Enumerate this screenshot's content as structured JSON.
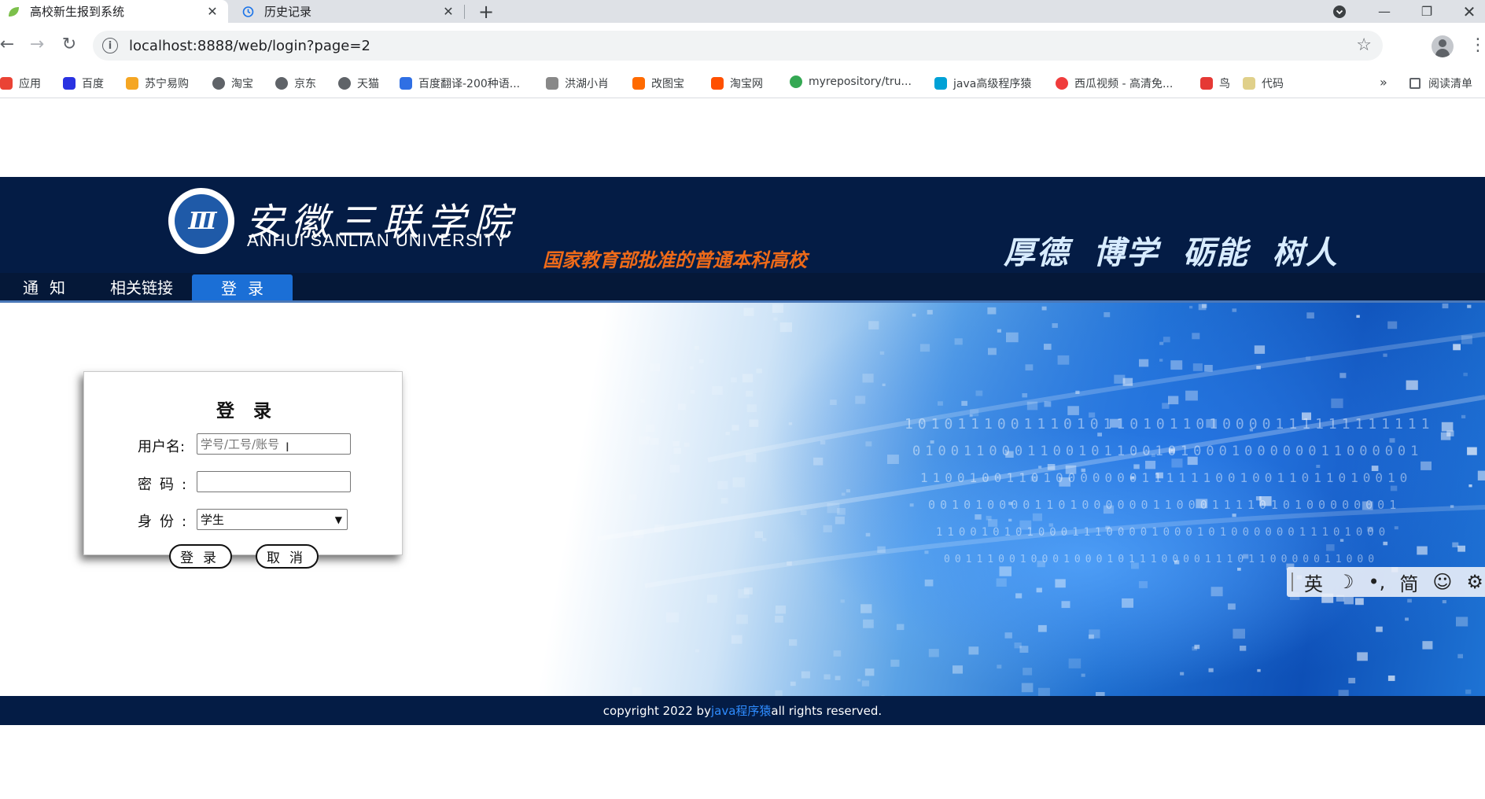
{
  "browser": {
    "tabs": [
      {
        "title": "高校新生报到系统",
        "active": true,
        "favicon": "leaf-icon"
      },
      {
        "title": "历史记录",
        "active": false,
        "favicon": "history-icon"
      }
    ],
    "new_tab": "+",
    "url": "localhost:8888/web/login?page=2",
    "bookmarks": [
      {
        "label": "应用",
        "icon": "apps-grid-icon",
        "color": "#ea4335"
      },
      {
        "label": "百度",
        "icon": "baidu-icon",
        "color": "#2932e1"
      },
      {
        "label": "苏宁易购",
        "icon": "suning-icon",
        "color": "#f5a623"
      },
      {
        "label": "淘宝",
        "icon": "globe-icon",
        "color": "#5f6368"
      },
      {
        "label": "京东",
        "icon": "globe-icon",
        "color": "#5f6368"
      },
      {
        "label": "天猫",
        "icon": "globe-icon",
        "color": "#5f6368"
      },
      {
        "label": "百度翻译-200种语...",
        "icon": "translate-icon",
        "color": "#2f6fe4"
      },
      {
        "label": "洪湖小肖",
        "icon": "bird-icon",
        "color": "#888888"
      },
      {
        "label": "改图宝",
        "icon": "gaitubao-icon",
        "color": "#ff6a00"
      },
      {
        "label": "淘宝网",
        "icon": "taobao-icon",
        "color": "#ff5000"
      },
      {
        "label": "myrepository/tru...",
        "icon": "chrome-icon",
        "color": "#34a853"
      },
      {
        "label": "java高级程序猿",
        "icon": "bilibili-icon",
        "color": "#00a1d6"
      },
      {
        "label": "西瓜视频 - 高清免...",
        "icon": "xigua-icon",
        "color": "#f03c3c"
      },
      {
        "label": "鸟",
        "icon": "bird-red-icon",
        "color": "#e53935"
      },
      {
        "label": "代码",
        "icon": "moon-icon",
        "color": "#e0d08a"
      }
    ],
    "bookmarks_more": "»",
    "reading_list": "阅读清单"
  },
  "site": {
    "logo_cn": "安徽三联学院",
    "logo_en": "ANHUI SANLIAN UNIVERSITY",
    "logo_mark": "III",
    "slogan_left": "国家教育部批准的普通本科高校",
    "slogan_right": "厚德 博学 砺能 树人",
    "nav": {
      "notice": "通知",
      "links": "相关链接",
      "login": "登录"
    }
  },
  "login": {
    "title": "登录",
    "username_label": "用户名:",
    "username_placeholder": "学号/工号/账号",
    "password_label": "密码:",
    "role_label": "身份:",
    "role_selected": "学生",
    "login_button": "登录",
    "cancel_button": "取消"
  },
  "ime": {
    "lang": "英",
    "moon": "☽",
    "punct": "•,",
    "simplified": "简",
    "emoji": "☺",
    "gear": "⚙"
  },
  "footer": {
    "prefix": "copyright 2022 by ",
    "author": "java程序猿",
    "suffix": " all rights reserved."
  },
  "colors": {
    "header_bg": "#041c45",
    "nav_active": "#1b6fd6",
    "slogan_orange": "#ee6a19",
    "footer_link": "#2e8cff"
  }
}
